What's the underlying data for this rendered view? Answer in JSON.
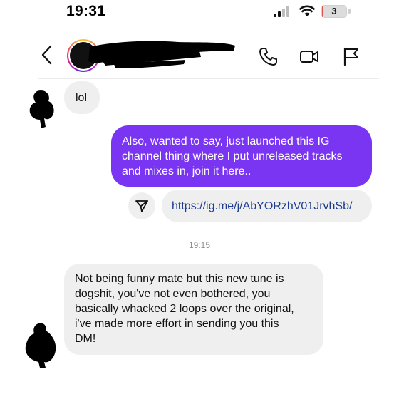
{
  "status_bar": {
    "time": "19:31",
    "battery_level": "3",
    "battery_fraction": 0.03,
    "signal_icon": "cellular-signal-icon",
    "wifi_icon": "wifi-icon"
  },
  "header": {
    "back_icon": "chevron-left-icon",
    "contact_name": "",
    "call_icon": "phone-icon",
    "video_icon": "video-camera-icon",
    "report_icon": "flag-icon"
  },
  "messages": [
    {
      "from": "contact",
      "text": "lol"
    },
    {
      "from": "me",
      "lines": [
        "Also, wanted to say, just launched this IG",
        "channel thing where I put unreleased tracks",
        "and mixes in, join it here.."
      ]
    },
    {
      "from": "me",
      "type": "link",
      "text": "https://ig.me/j/AbYORzhV01JrvhSb/"
    },
    {
      "timestamp": "19:15"
    },
    {
      "from": "contact",
      "lines": [
        "Not being funny mate but this new tune is",
        "dogshit, you've not even bothered, you",
        "basically whacked 2 loops over the original,",
        "i've made more effort in sending you this",
        "DM!"
      ]
    }
  ],
  "colors": {
    "outgoing_bubble": "#7a35f3",
    "incoming_bubble": "#efefef",
    "link_text": "#1d3c8f",
    "timestamp": "#8e8e8e"
  }
}
